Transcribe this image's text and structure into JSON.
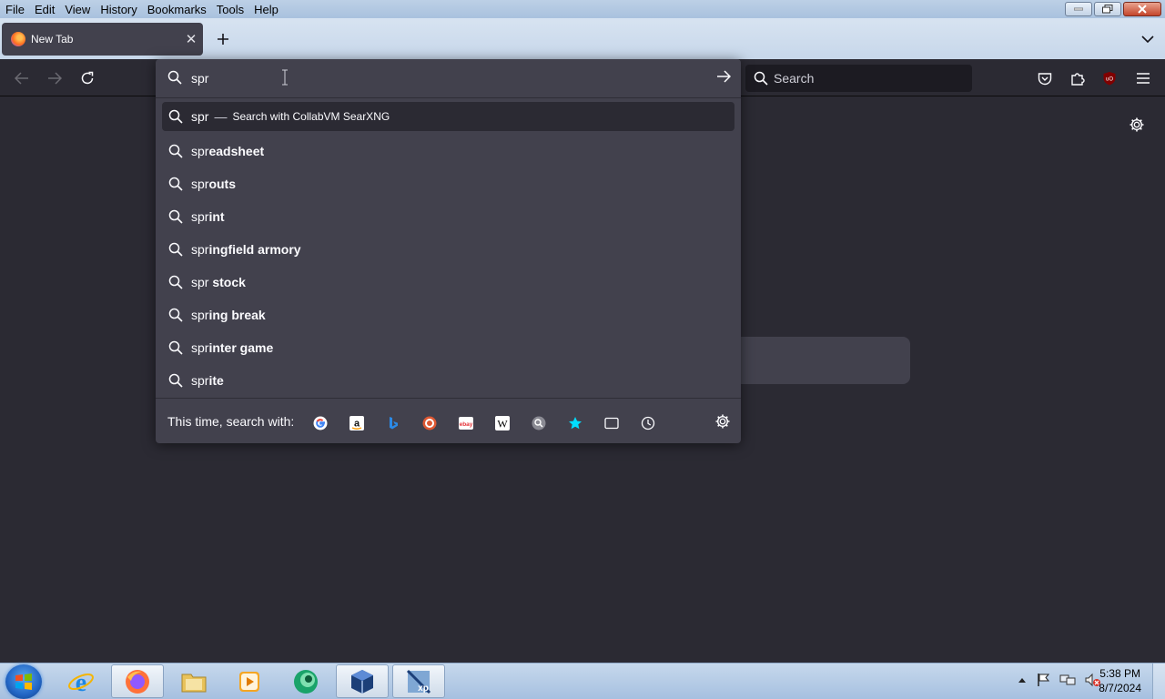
{
  "menubar": {
    "items": [
      {
        "label": "File"
      },
      {
        "label": "Edit"
      },
      {
        "label": "View"
      },
      {
        "label": "History"
      },
      {
        "label": "Bookmarks"
      },
      {
        "label": "Tools"
      },
      {
        "label": "Help"
      }
    ]
  },
  "tabs": [
    {
      "title": "New Tab",
      "active": true
    }
  ],
  "toolbar": {
    "search_placeholder": "Search"
  },
  "urlbar": {
    "value": "spr",
    "heuristic": {
      "typed": "spr",
      "separator": "—",
      "action": "Search with CollabVM SearXNG"
    },
    "suggestions": [
      {
        "typed": "spr",
        "completion": "eadsheet"
      },
      {
        "typed": "spr",
        "completion": "outs"
      },
      {
        "typed": "spr",
        "completion": "int"
      },
      {
        "typed": "spr",
        "completion": "ingfield armory"
      },
      {
        "typed": "spr",
        "completion": " stock"
      },
      {
        "typed": "spr",
        "completion": "ing break"
      },
      {
        "typed": "spr",
        "completion": "inter game"
      },
      {
        "typed": "spr",
        "completion": "ite"
      }
    ],
    "oneoff_label": "This time, search with:",
    "engines": [
      "google-icon",
      "amazon-icon",
      "bing-icon",
      "duckduckgo-icon",
      "ebay-icon",
      "wikipedia-icon",
      "searxng-icon",
      "bookmarks-icon",
      "tabs-icon",
      "history-icon"
    ]
  },
  "taskbar": {
    "clock_time": "5:38 PM",
    "clock_date": "8/7/2024"
  },
  "colors": {
    "toolbar_bg": "#2b2a33",
    "popup_bg": "#42414d",
    "text": "#fbfbfe",
    "titlebar": "#bdd0e6"
  }
}
